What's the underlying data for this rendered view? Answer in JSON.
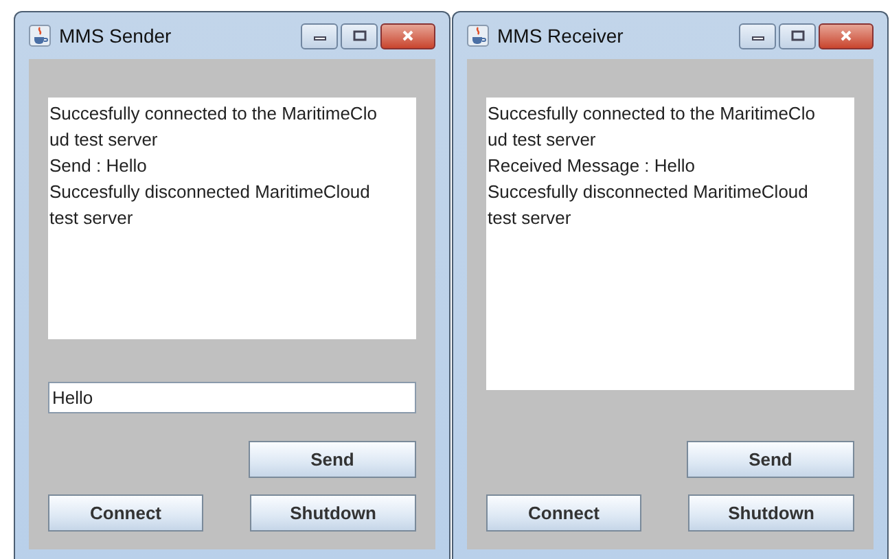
{
  "windows": [
    {
      "title": "MMS Sender",
      "log_lines": [
        "Succesfully connected to the MaritimeClo",
        "ud test server",
        "Send : Hello",
        "Succesfully disconnected MaritimeCloud",
        "test server"
      ],
      "message_field": {
        "value": "Hello"
      },
      "buttons": [
        {
          "kind": "send",
          "label": "Send"
        },
        {
          "kind": "connect",
          "label": "Connect"
        },
        {
          "kind": "shutdown",
          "label": "Shutdown"
        }
      ]
    },
    {
      "title": "MMS Receiver",
      "log_lines": [
        "Succesfully connected to the MaritimeClo",
        "ud test server",
        "Received Message : Hello",
        "Succesfully disconnected MaritimeCloud",
        "test server"
      ],
      "buttons": [
        {
          "kind": "send",
          "label": "Send"
        },
        {
          "kind": "connect",
          "label": "Connect"
        },
        {
          "kind": "shutdown",
          "label": "Shutdown"
        }
      ]
    }
  ]
}
